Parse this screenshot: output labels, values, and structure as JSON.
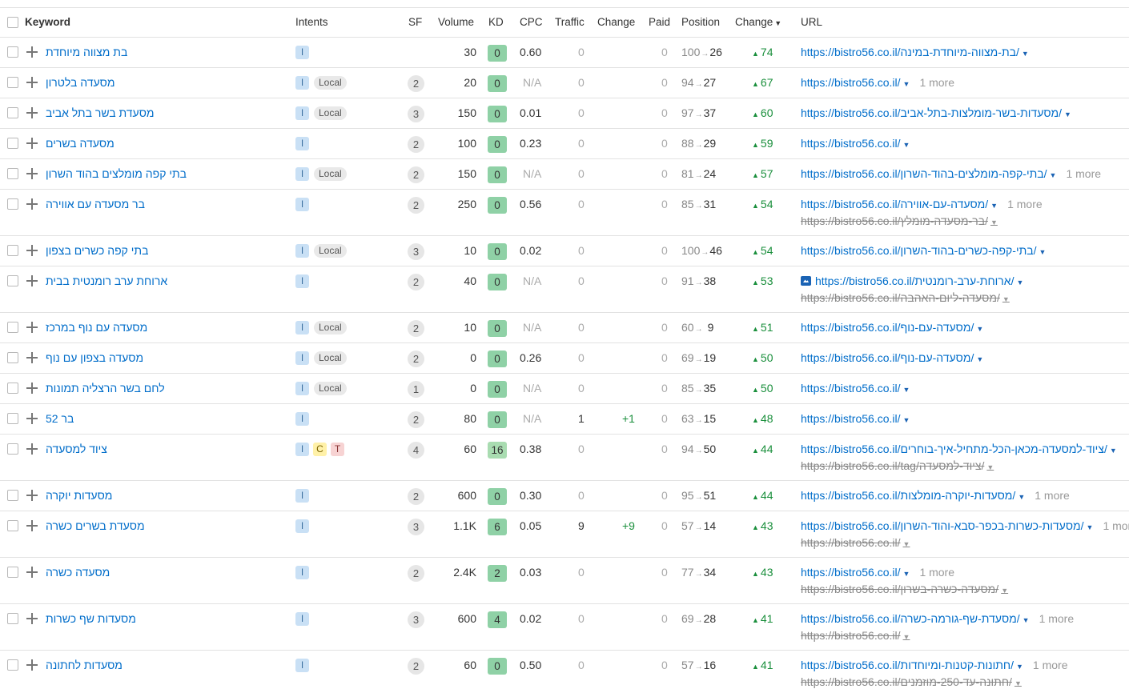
{
  "headers": {
    "keyword": "Keyword",
    "intents": "Intents",
    "sf": "SF",
    "volume": "Volume",
    "kd": "KD",
    "cpc": "CPC",
    "traffic": "Traffic",
    "change": "Change",
    "paid": "Paid",
    "position": "Position",
    "change_sorted": "Change",
    "url": "URL"
  },
  "rows": [
    {
      "keyword": "בת מצווה מיוחדת",
      "intents": [
        "I"
      ],
      "local": "",
      "sf": "",
      "volume": "30",
      "kd": "0",
      "cpc": "0.60",
      "traffic": "0",
      "tchange": "",
      "paid": "0",
      "pos_old": "100",
      "pos_new": "26",
      "change": "74",
      "url": "https://bistro56.co.il/בת-מצווה-מיוחדת-במינה/",
      "url_more": "",
      "url2": ""
    },
    {
      "keyword": "מסעדה בלטרון",
      "intents": [
        "I"
      ],
      "local": "Local",
      "sf": "2",
      "volume": "20",
      "kd": "0",
      "cpc": "N/A",
      "traffic": "0",
      "tchange": "",
      "paid": "0",
      "pos_old": "94",
      "pos_new": "27",
      "change": "67",
      "url": "https://bistro56.co.il/",
      "url_more": "1 more",
      "url2": ""
    },
    {
      "keyword": "מסעדת בשר בתל אביב",
      "intents": [
        "I"
      ],
      "local": "Local",
      "sf": "3",
      "volume": "150",
      "kd": "0",
      "cpc": "0.01",
      "traffic": "0",
      "tchange": "",
      "paid": "0",
      "pos_old": "97",
      "pos_new": "37",
      "change": "60",
      "url": "https://bistro56.co.il/מסעדות-בשר-מומלצות-בתל-אביב/",
      "url_more": "",
      "url2": ""
    },
    {
      "keyword": "מסעדה בשרים",
      "intents": [
        "I"
      ],
      "local": "",
      "sf": "2",
      "volume": "100",
      "kd": "0",
      "cpc": "0.23",
      "traffic": "0",
      "tchange": "",
      "paid": "0",
      "pos_old": "88",
      "pos_new": "29",
      "change": "59",
      "url": "https://bistro56.co.il/",
      "url_more": "",
      "url2": ""
    },
    {
      "keyword": "בתי קפה מומלצים בהוד השרון",
      "intents": [
        "I"
      ],
      "local": "Local",
      "sf": "2",
      "volume": "150",
      "kd": "0",
      "cpc": "N/A",
      "traffic": "0",
      "tchange": "",
      "paid": "0",
      "pos_old": "81",
      "pos_new": "24",
      "change": "57",
      "url": "https://bistro56.co.il/בתי-קפה-מומלצים-בהוד-השרון/",
      "url_more": "1 more",
      "url2": ""
    },
    {
      "keyword": "בר מסעדה עם אווירה",
      "intents": [
        "I"
      ],
      "local": "",
      "sf": "2",
      "volume": "250",
      "kd": "0",
      "cpc": "0.56",
      "traffic": "0",
      "tchange": "",
      "paid": "0",
      "pos_old": "85",
      "pos_new": "31",
      "change": "54",
      "url": "https://bistro56.co.il/מסעדה-עם-אווירה/",
      "url_more": "1 more",
      "url2": "https://bistro56.co.il/בר-מסעדה-מומלץ/"
    },
    {
      "keyword": "בתי קפה כשרים בצפון",
      "intents": [
        "I"
      ],
      "local": "Local",
      "sf": "3",
      "volume": "10",
      "kd": "0",
      "cpc": "0.02",
      "traffic": "0",
      "tchange": "",
      "paid": "0",
      "pos_old": "100",
      "pos_new": "46",
      "change": "54",
      "url": "https://bistro56.co.il/בתי-קפה-כשרים-בהוד-השרון/",
      "url_more": "",
      "url2": ""
    },
    {
      "keyword": "ארוחת ערב רומנטית בבית",
      "intents": [
        "I"
      ],
      "local": "",
      "sf": "2",
      "volume": "40",
      "kd": "0",
      "cpc": "N/A",
      "traffic": "0",
      "tchange": "",
      "paid": "0",
      "pos_old": "91",
      "pos_new": "38",
      "change": "53",
      "url": "https://bistro56.co.il/ארוחת-ערב-רומנטית/",
      "url_more": "",
      "url2": "https://bistro56.co.il/מסעדה-ליום-האהבה/",
      "image_icon": true
    },
    {
      "keyword": "מסעדה עם נוף במרכז",
      "intents": [
        "I"
      ],
      "local": "Local",
      "sf": "2",
      "volume": "10",
      "kd": "0",
      "cpc": "N/A",
      "traffic": "0",
      "tchange": "",
      "paid": "0",
      "pos_old": "60",
      "pos_new": "9",
      "change": "51",
      "url": "https://bistro56.co.il/מסעדה-עם-נוף/",
      "url_more": "",
      "url2": ""
    },
    {
      "keyword": "מסעדה בצפון עם נוף",
      "intents": [
        "I"
      ],
      "local": "Local",
      "sf": "2",
      "volume": "0",
      "kd": "0",
      "cpc": "0.26",
      "traffic": "0",
      "tchange": "",
      "paid": "0",
      "pos_old": "69",
      "pos_new": "19",
      "change": "50",
      "url": "https://bistro56.co.il/מסעדה-עם-נוף/",
      "url_more": "",
      "url2": ""
    },
    {
      "keyword": "לחם בשר הרצליה תמונות",
      "intents": [
        "I"
      ],
      "local": "Local",
      "sf": "1",
      "volume": "0",
      "kd": "0",
      "cpc": "N/A",
      "traffic": "0",
      "tchange": "",
      "paid": "0",
      "pos_old": "85",
      "pos_new": "35",
      "change": "50",
      "url": "https://bistro56.co.il/",
      "url_more": "",
      "url2": ""
    },
    {
      "keyword": "בר 52",
      "intents": [
        "I"
      ],
      "local": "",
      "sf": "2",
      "volume": "80",
      "kd": "0",
      "cpc": "N/A",
      "traffic": "1",
      "tchange": "+1",
      "paid": "0",
      "pos_old": "63",
      "pos_new": "15",
      "change": "48",
      "url": "https://bistro56.co.il/",
      "url_more": "",
      "url2": ""
    },
    {
      "keyword": "ציוד למסעדה",
      "intents": [
        "I",
        "C",
        "T"
      ],
      "local": "",
      "sf": "4",
      "volume": "60",
      "kd": "16",
      "cpc": "0.38",
      "traffic": "0",
      "tchange": "",
      "paid": "0",
      "pos_old": "94",
      "pos_new": "50",
      "change": "44",
      "url": "https://bistro56.co.il/ציוד-למסעדה-מכאן-הכל-מתחיל-איך-בוחרים/",
      "url_more": "",
      "url2": "https://bistro56.co.il/tag/ציוד-למסעדה/"
    },
    {
      "keyword": "מסעדות יוקרה",
      "intents": [
        "I"
      ],
      "local": "",
      "sf": "2",
      "volume": "600",
      "kd": "0",
      "cpc": "0.30",
      "traffic": "0",
      "tchange": "",
      "paid": "0",
      "pos_old": "95",
      "pos_new": "51",
      "change": "44",
      "url": "https://bistro56.co.il/מסעדות-יוקרה-מומלצות/",
      "url_more": "1 more",
      "url2": ""
    },
    {
      "keyword": "מסעדת בשרים כשרה",
      "intents": [
        "I"
      ],
      "local": "",
      "sf": "3",
      "volume": "1.1K",
      "kd": "6",
      "cpc": "0.05",
      "traffic": "9",
      "tchange": "+9",
      "paid": "0",
      "pos_old": "57",
      "pos_new": "14",
      "change": "43",
      "url": "https://bistro56.co.il/מסעדות-כשרות-בכפר-סבא-והוד-השרון/",
      "url_more": "1 more",
      "url2": "https://bistro56.co.il/"
    },
    {
      "keyword": "מסעדה כשרה",
      "intents": [
        "I"
      ],
      "local": "",
      "sf": "2",
      "volume": "2.4K",
      "kd": "2",
      "cpc": "0.03",
      "traffic": "0",
      "tchange": "",
      "paid": "0",
      "pos_old": "77",
      "pos_new": "34",
      "change": "43",
      "url": "https://bistro56.co.il/",
      "url_more": "1 more",
      "url2": "https://bistro56.co.il/מסעדה-כשרה-בשרון/"
    },
    {
      "keyword": "מסעדות שף כשרות",
      "intents": [
        "I"
      ],
      "local": "",
      "sf": "3",
      "volume": "600",
      "kd": "4",
      "cpc": "0.02",
      "traffic": "0",
      "tchange": "",
      "paid": "0",
      "pos_old": "69",
      "pos_new": "28",
      "change": "41",
      "url": "https://bistro56.co.il/מסעדת-שף-גורמה-כשרה/",
      "url_more": "1 more",
      "url2": "https://bistro56.co.il/"
    },
    {
      "keyword": "מסעדות לחתונה",
      "intents": [
        "I"
      ],
      "local": "",
      "sf": "2",
      "volume": "60",
      "kd": "0",
      "cpc": "0.50",
      "traffic": "0",
      "tchange": "",
      "paid": "0",
      "pos_old": "57",
      "pos_new": "16",
      "change": "41",
      "url": "https://bistro56.co.il/חתונות-קטנות-ומיוחדות/",
      "url_more": "1 more",
      "url2": "https://bistro56.co.il/חתונה-עד-250-מוזמנים/"
    }
  ]
}
